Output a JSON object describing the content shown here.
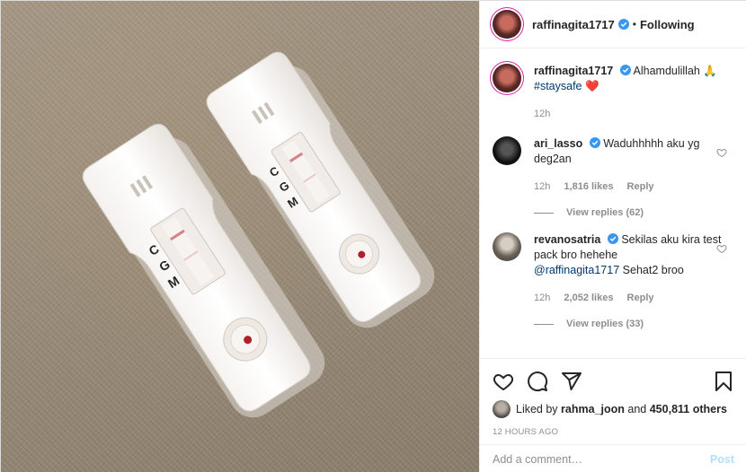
{
  "post": {
    "author": "raffinagita1717",
    "follow_status": "Following",
    "caption_author": "raffinagita1717",
    "caption_text": "Alhamdulillah 🙏",
    "caption_hashtag": "#staysafe",
    "caption_emoji": "❤️",
    "caption_time": "12h"
  },
  "comments": [
    {
      "user": "ari_lasso",
      "text": "Waduhhhhh aku yg deg2an",
      "time": "12h",
      "likes": "1,816 likes",
      "reply": "Reply",
      "view_replies": "View replies (62)"
    },
    {
      "user": "revanosatria",
      "text": "Sekilas aku kira test pack bro hehehe",
      "mention": "@raffinagita1717",
      "text2": "Sehat2 broo",
      "time": "12h",
      "likes": "2,052 likes",
      "reply": "Reply",
      "view_replies": "View replies (33)"
    }
  ],
  "likes": {
    "prefix": "Liked by",
    "user": "rahma_joon",
    "and": "and",
    "count": "450,811 others"
  },
  "timestamp": "12 HOURS AGO",
  "add_comment": {
    "placeholder": "Add a comment…",
    "post_label": "Post"
  },
  "photo": {
    "test_labels": [
      "C",
      "G",
      "M"
    ]
  },
  "colors": {
    "verified": "#3897f0",
    "heart": "#ed4956",
    "hashtag": "#00376b",
    "post_disabled": "#b2dffc"
  }
}
